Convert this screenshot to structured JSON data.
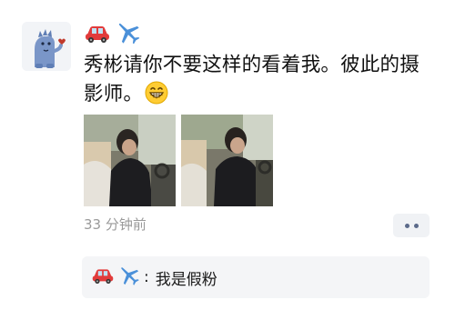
{
  "post": {
    "author": {
      "avatar_icon": "blue-dinosaur-avatar-icon",
      "name_icons": [
        "car-icon",
        "airplane-icon"
      ]
    },
    "text_main": "秀彬请你不要这样的看着我。彼此的摄影师。",
    "text_emoji": "grinning-face-icon",
    "photos": [
      {
        "icon": "photo-man-in-car-icon"
      },
      {
        "icon": "photo-man-in-car-icon"
      }
    ],
    "timestamp": "33 分钟前",
    "more_icon": "more-dots-icon"
  },
  "comment": {
    "commenter_icons": [
      "car-icon",
      "airplane-icon"
    ],
    "separator": ":",
    "text": "我是假粉"
  },
  "colors": {
    "timestamp": "#9a9a9a",
    "link_blue": "#5b6a8a",
    "comment_bg": "#f4f5f7",
    "avatar_blue": "#7a96c8"
  }
}
